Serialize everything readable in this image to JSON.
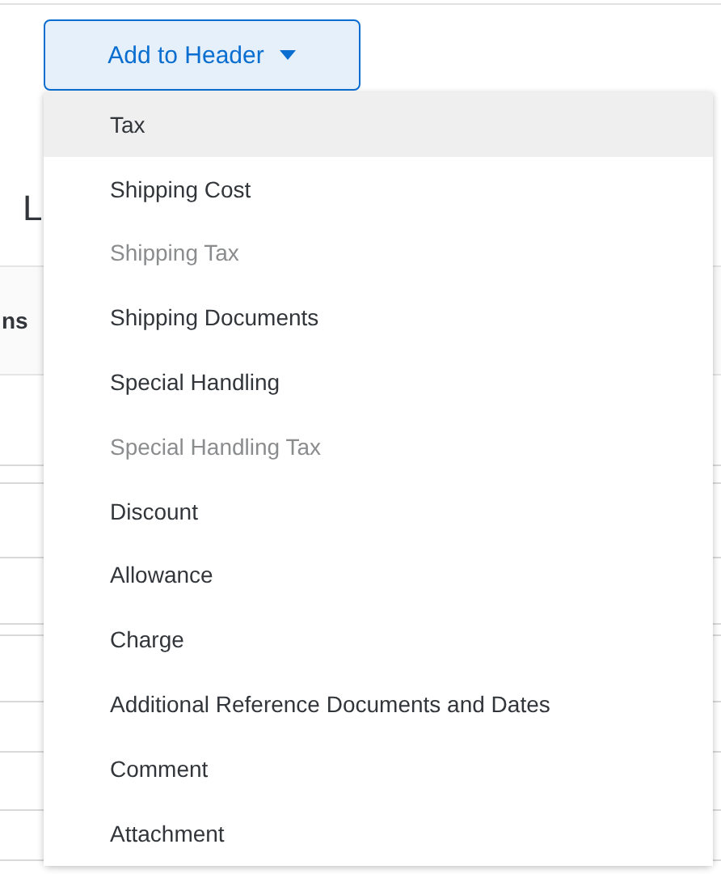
{
  "button": {
    "label": "Add to Header",
    "expanded": true
  },
  "heading": "L",
  "table": {
    "columns": [
      "ns"
    ]
  },
  "menu": {
    "items": [
      {
        "label": "Tax",
        "selected": true,
        "disabled": false
      },
      {
        "label": "Shipping Cost",
        "selected": false,
        "disabled": false
      },
      {
        "label": "Shipping Tax",
        "selected": false,
        "disabled": true
      },
      {
        "label": "Shipping Documents",
        "selected": false,
        "disabled": false
      },
      {
        "label": "Special Handling",
        "selected": false,
        "disabled": false
      },
      {
        "label": "Special Handling Tax",
        "selected": false,
        "disabled": true
      },
      {
        "label": "Discount",
        "selected": false,
        "disabled": false
      },
      {
        "label": "Allowance",
        "selected": false,
        "disabled": false
      },
      {
        "label": "Charge",
        "selected": false,
        "disabled": false
      },
      {
        "label": "Additional Reference Documents and Dates",
        "selected": false,
        "disabled": false
      },
      {
        "label": "Comment",
        "selected": false,
        "disabled": false
      },
      {
        "label": "Attachment",
        "selected": false,
        "disabled": false
      }
    ]
  }
}
